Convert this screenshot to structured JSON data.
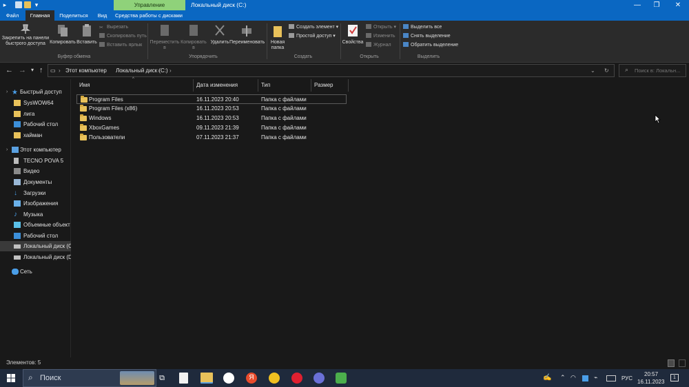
{
  "window": {
    "context_tab": "Управление",
    "title": "Локальный диск (C:)"
  },
  "ribbon_tabs": [
    "Файл",
    "Главная",
    "Поделиться",
    "Вид",
    "Средства работы с дисками"
  ],
  "ribbon": {
    "clipboard": {
      "pin": "Закрепить на панели быстрого доступа",
      "copy": "Копировать",
      "paste": "Вставить",
      "cut": "Вырезать",
      "copy_path": "Скопировать путь",
      "paste_shortcut": "Вставить ярлык",
      "group": "Буфер обмена"
    },
    "organize": {
      "move": "Переместить в",
      "copy_to": "Копировать в",
      "delete": "Удалить",
      "rename": "Переименовать",
      "group": "Упорядочить"
    },
    "create": {
      "new_folder": "Новая папка",
      "new_item": "Создать элемент",
      "easy_access": "Простой доступ",
      "group": "Создать"
    },
    "open": {
      "properties": "Свойства",
      "open": "Открыть",
      "edit": "Изменить",
      "history": "Журнал",
      "group": "Открыть"
    },
    "select": {
      "select_all": "Выделить все",
      "select_none": "Снять выделение",
      "invert": "Обратить выделение",
      "group": "Выделить"
    }
  },
  "address": {
    "crumbs": [
      "Этот компьютер",
      "Локальный диск (C:)"
    ],
    "search_placeholder": "Поиск в: Локальн..."
  },
  "sidebar": [
    {
      "label": "Быстрый доступ",
      "icon": "star-icon"
    },
    {
      "label": "SysWOW64",
      "icon": "folder-icon"
    },
    {
      "label": "лига",
      "icon": "folder-icon"
    },
    {
      "label": "Рабочий стол",
      "icon": "desktop-icon"
    },
    {
      "label": "хайман",
      "icon": "folder-icon"
    },
    {
      "label": "Этот компьютер",
      "icon": "computer-icon"
    },
    {
      "label": "TECNO POVA 5",
      "icon": "phone-icon"
    },
    {
      "label": "Видео",
      "icon": "video-icon"
    },
    {
      "label": "Документы",
      "icon": "documents-icon"
    },
    {
      "label": "Загрузки",
      "icon": "download-icon"
    },
    {
      "label": "Изображения",
      "icon": "pictures-icon"
    },
    {
      "label": "Музыка",
      "icon": "music-icon"
    },
    {
      "label": "Объемные объект",
      "icon": "objects-3d-icon"
    },
    {
      "label": "Рабочий стол",
      "icon": "desktop-icon"
    },
    {
      "label": "Локальный диск (C",
      "icon": "drive-icon"
    },
    {
      "label": "Локальный диск (D",
      "icon": "drive-icon"
    },
    {
      "label": "Сеть",
      "icon": "network-icon"
    }
  ],
  "columns": [
    "Имя",
    "Дата изменения",
    "Тип",
    "Размер"
  ],
  "files": [
    {
      "name": "Program Files",
      "date": "16.11.2023 20:40",
      "type": "Папка с файлами"
    },
    {
      "name": "Program Files (x86)",
      "date": "16.11.2023 20:53",
      "type": "Папка с файлами"
    },
    {
      "name": "Windows",
      "date": "16.11.2023 20:53",
      "type": "Папка с файлами"
    },
    {
      "name": "XboxGames",
      "date": "09.11.2023 21:39",
      "type": "Папка с файлами"
    },
    {
      "name": "Пользователи",
      "date": "07.11.2023 21:37",
      "type": "Папка с файлами"
    }
  ],
  "status": "Элементов: 5",
  "taskbar": {
    "search": "Поиск",
    "lang": "РУС",
    "time": "20:57",
    "date": "16.11.2023",
    "notifications": "1"
  },
  "colors": {
    "titlebar": "#0a67c2",
    "context_tab": "#8fd27a",
    "folder": "#e8c15a",
    "background": "#191919"
  }
}
